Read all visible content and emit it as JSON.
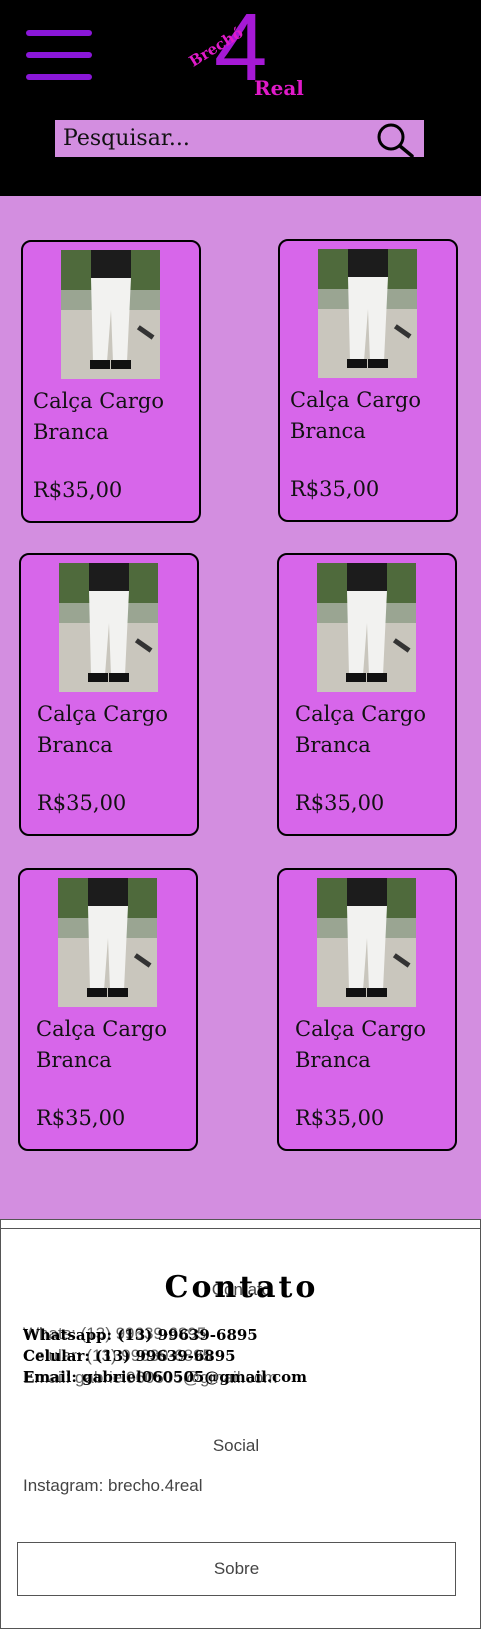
{
  "header": {
    "logo": {
      "brecho": "Brechó",
      "number": "4",
      "real": "Real"
    },
    "search": {
      "placeholder": "Pesquisar..."
    }
  },
  "products": [
    {
      "name": "Calça Cargo Branca",
      "price": "R$35,00"
    },
    {
      "name": "Calça Cargo Branca",
      "price": "R$35,00"
    },
    {
      "name": "Calça Cargo Branca",
      "price": "R$35,00"
    },
    {
      "name": "Calça Cargo Branca",
      "price": "R$35,00"
    },
    {
      "name": "Calça Cargo Branca",
      "price": "R$35,00"
    },
    {
      "name": "Calça Cargo Branca",
      "price": "R$35,00"
    }
  ],
  "footer": {
    "contato_title": "Contato",
    "contato_subtitle": "Contato",
    "whatsapp_bold": "Whatsapp: (13) 99639-6895",
    "celular_bold": "Celular: (13) 99639-6895",
    "email_bold": "Email: gabriel060505@gmail.com",
    "whats_thin": "Whats: (13) 99639-6895",
    "celular_thin": "Celular: (13) 99639-6895",
    "email_thin": "Email: gabriel060505@gmail.com",
    "social_title": "Social",
    "instagram": "Instagram: brecho.4real",
    "sobre_label": "Sobre"
  },
  "colors": {
    "header_bg": "#000000",
    "accent_purple": "#8a17d8",
    "logo_pink": "#e01ac9",
    "main_bg": "#d38ee0",
    "card_bg": "#d766ea"
  }
}
